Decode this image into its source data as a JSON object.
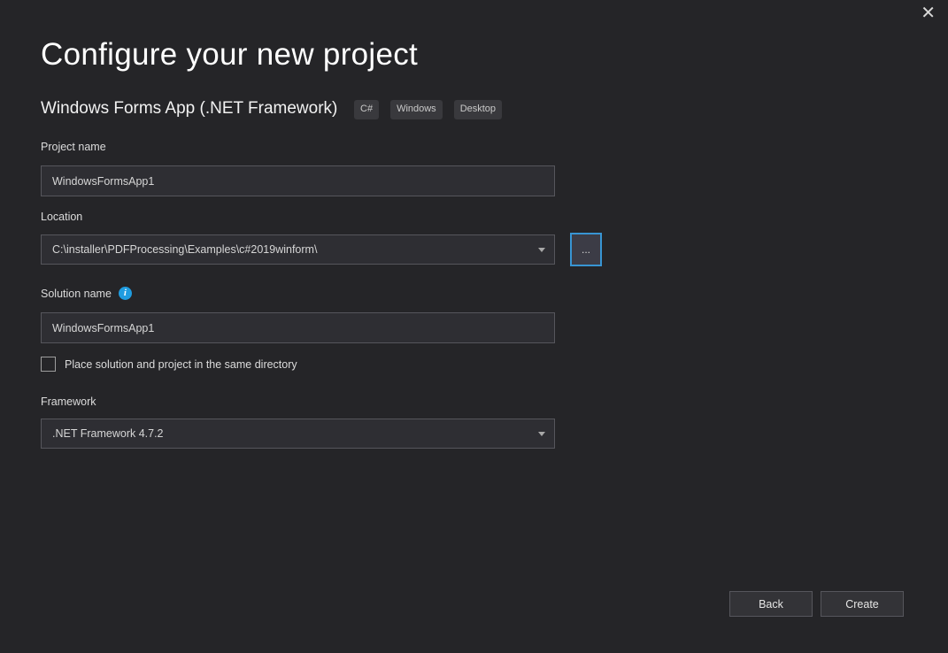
{
  "dialog": {
    "title": "Configure your new project",
    "subtitle": "Windows Forms App (.NET Framework)",
    "tags": [
      "C#",
      "Windows",
      "Desktop"
    ],
    "close_icon": "✕"
  },
  "fields": {
    "project_name": {
      "label": "Project name",
      "value": "WindowsFormsApp1"
    },
    "location": {
      "label": "Location",
      "value": "C:\\installer\\PDFProcessing\\Examples\\c#2019winform\\"
    },
    "browse_label": "...",
    "solution_name": {
      "label": "Solution name",
      "value": "WindowsFormsApp1"
    },
    "same_directory": {
      "label": "Place solution and project in the same directory",
      "checked": false
    },
    "framework": {
      "label": "Framework",
      "value": ".NET Framework 4.7.2"
    }
  },
  "buttons": {
    "back": "Back",
    "create": "Create"
  },
  "colors": {
    "accent": "#3895D3",
    "info": "#1F9CE0"
  }
}
